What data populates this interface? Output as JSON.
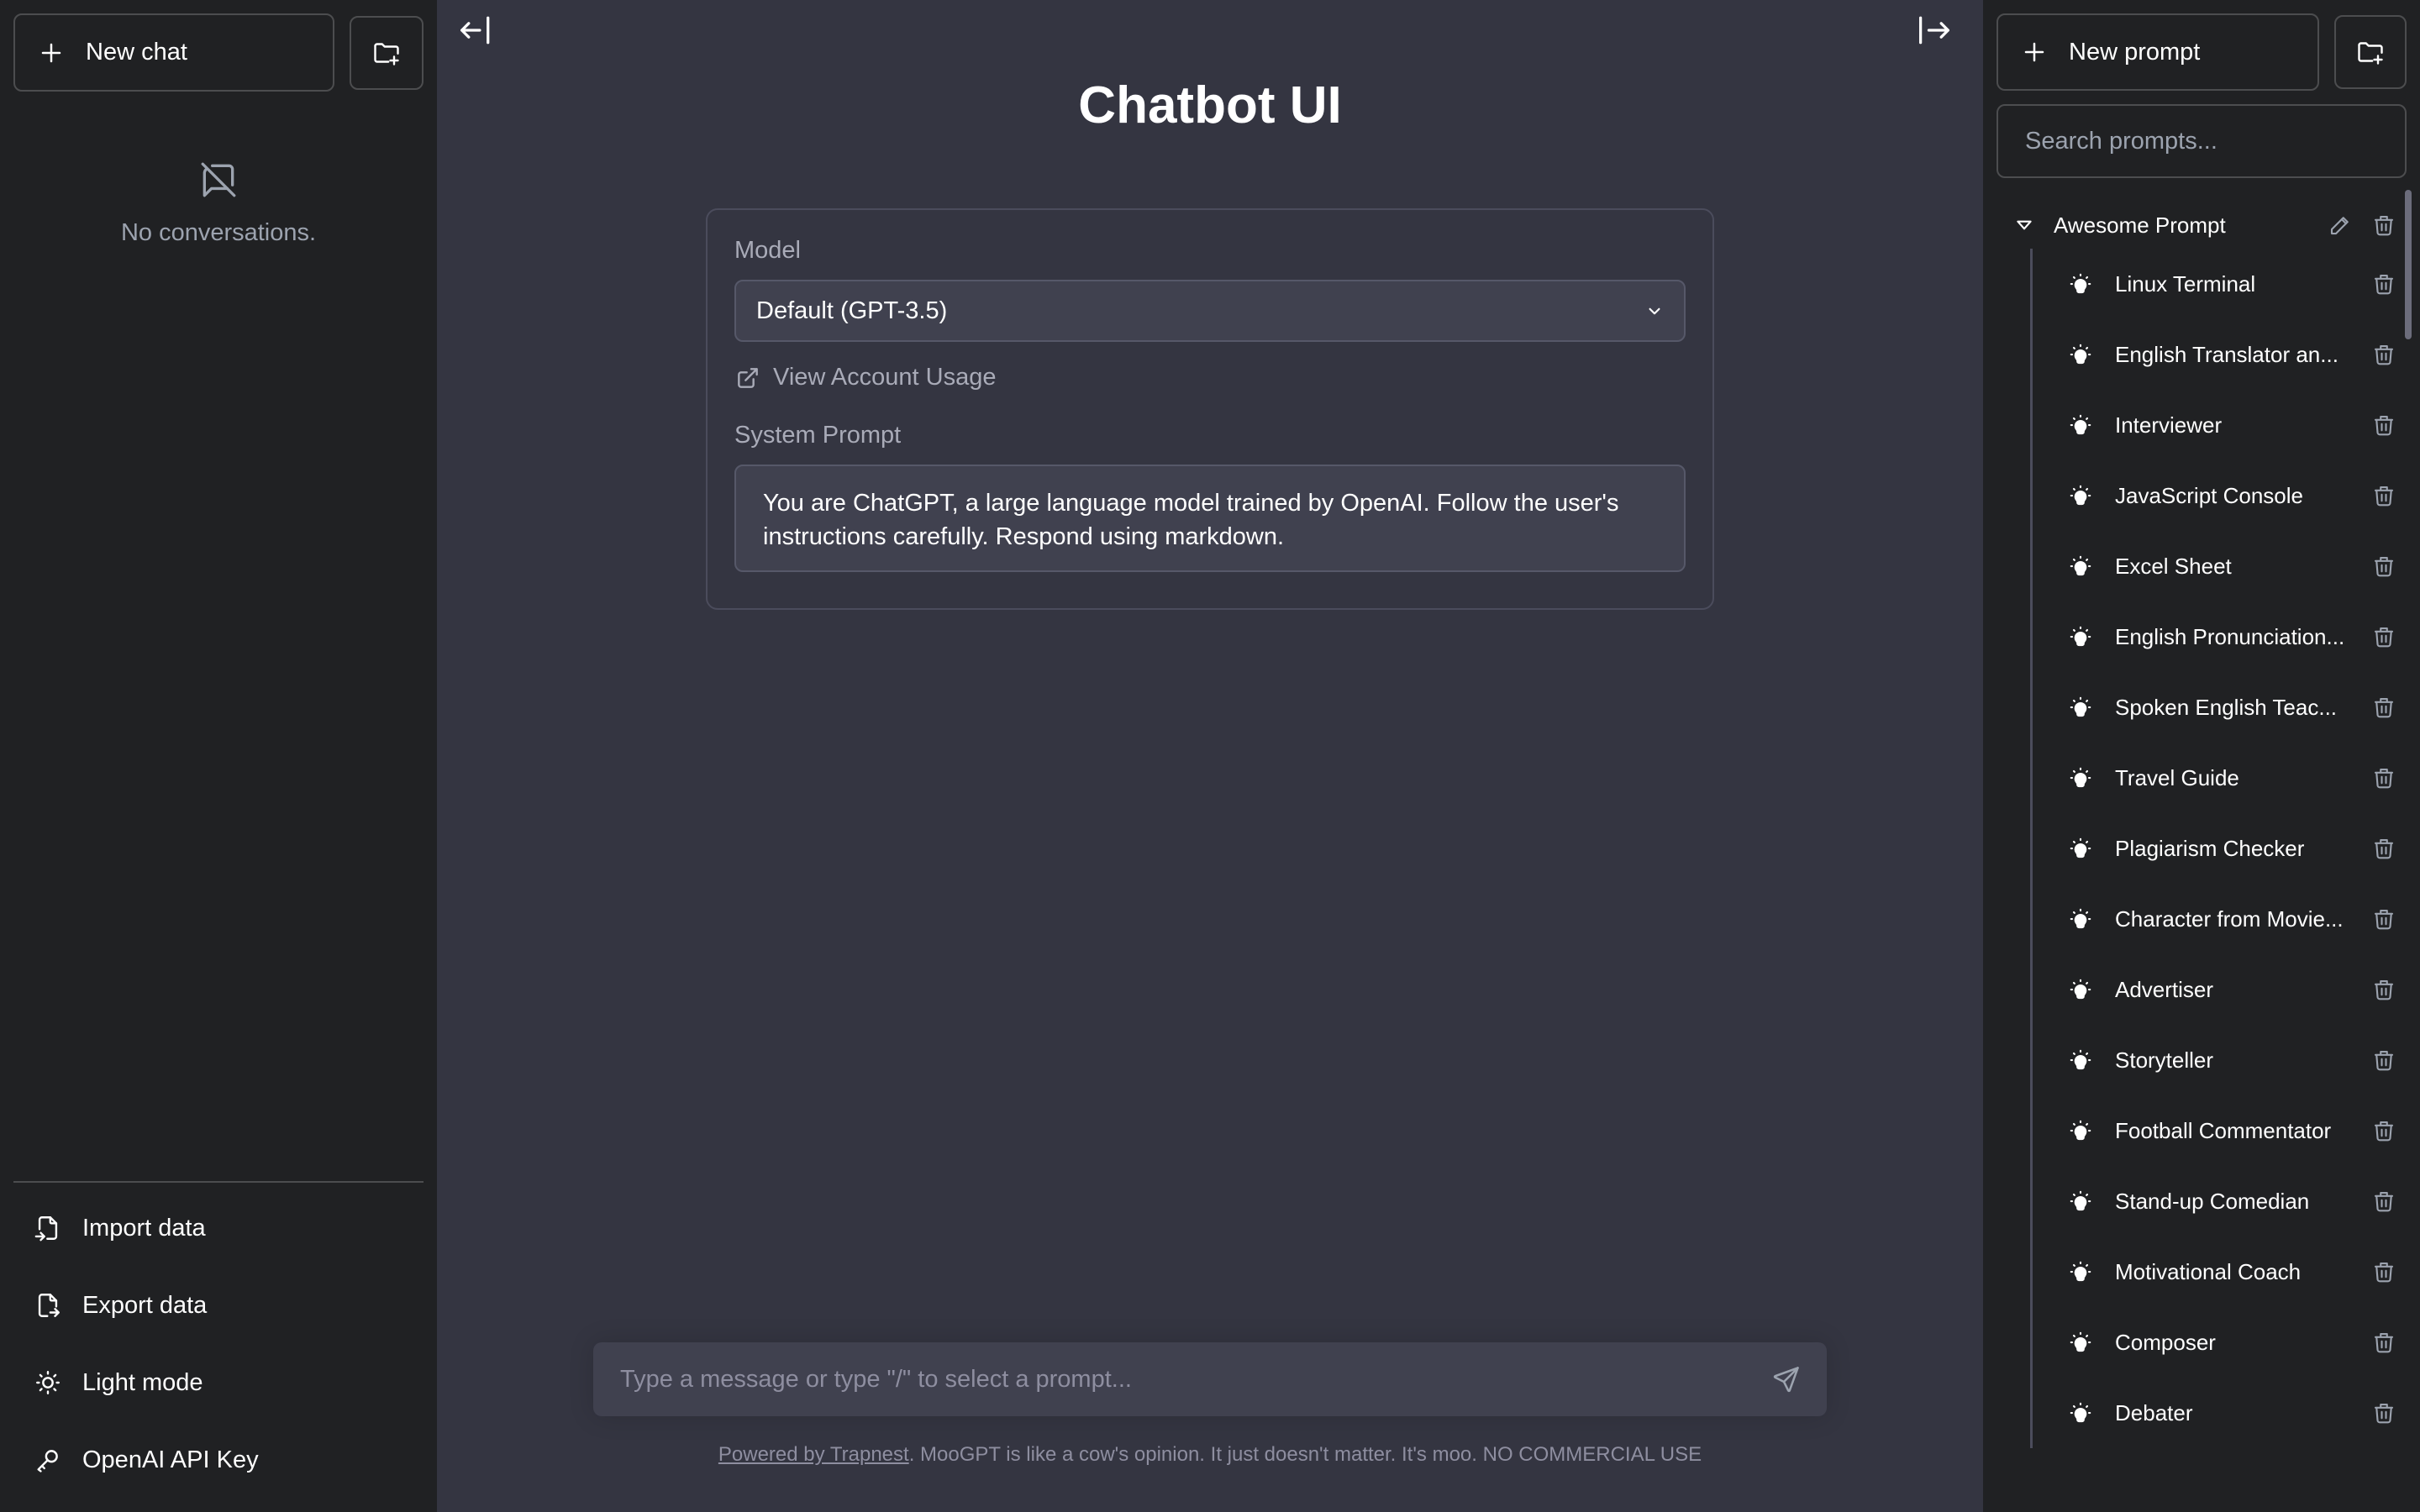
{
  "left_sidebar": {
    "new_chat_label": "New chat",
    "empty_text": "No conversations.",
    "bottom_items": [
      {
        "label": "Import data",
        "icon": "file-import-icon"
      },
      {
        "label": "Export data",
        "icon": "file-export-icon"
      },
      {
        "label": "Light mode",
        "icon": "sun-icon"
      },
      {
        "label": "OpenAI API Key",
        "icon": "key-icon"
      }
    ]
  },
  "main": {
    "title": "Chatbot UI",
    "model_label": "Model",
    "model_value": "Default (GPT-3.5)",
    "usage_link": "View Account Usage",
    "system_prompt_label": "System Prompt",
    "system_prompt_value": "You are ChatGPT, a large language model trained by OpenAI. Follow the user's instructions carefully. Respond using markdown.",
    "input_placeholder": "Type a message or type \"/\" to select a prompt...",
    "footer_link": "Powered by Trapnest",
    "footer_text": ". MooGPT is like a cow's opinion. It just doesn't matter. It's moo. NO COMMERCIAL USE"
  },
  "right_sidebar": {
    "new_prompt_label": "New prompt",
    "search_placeholder": "Search prompts...",
    "folder_name": "Awesome Prompt",
    "prompts": [
      "Linux Terminal",
      "English Translator an...",
      "Interviewer",
      "JavaScript Console",
      "Excel Sheet",
      "English Pronunciation...",
      "Spoken English Teac...",
      "Travel Guide",
      "Plagiarism Checker",
      "Character from Movie...",
      "Advertiser",
      "Storyteller",
      "Football Commentator",
      "Stand-up Comedian",
      "Motivational Coach",
      "Composer",
      "Debater"
    ]
  },
  "colors": {
    "main_bg": "#343541",
    "sidebar_bg": "#202123",
    "input_bg": "#40414f"
  }
}
